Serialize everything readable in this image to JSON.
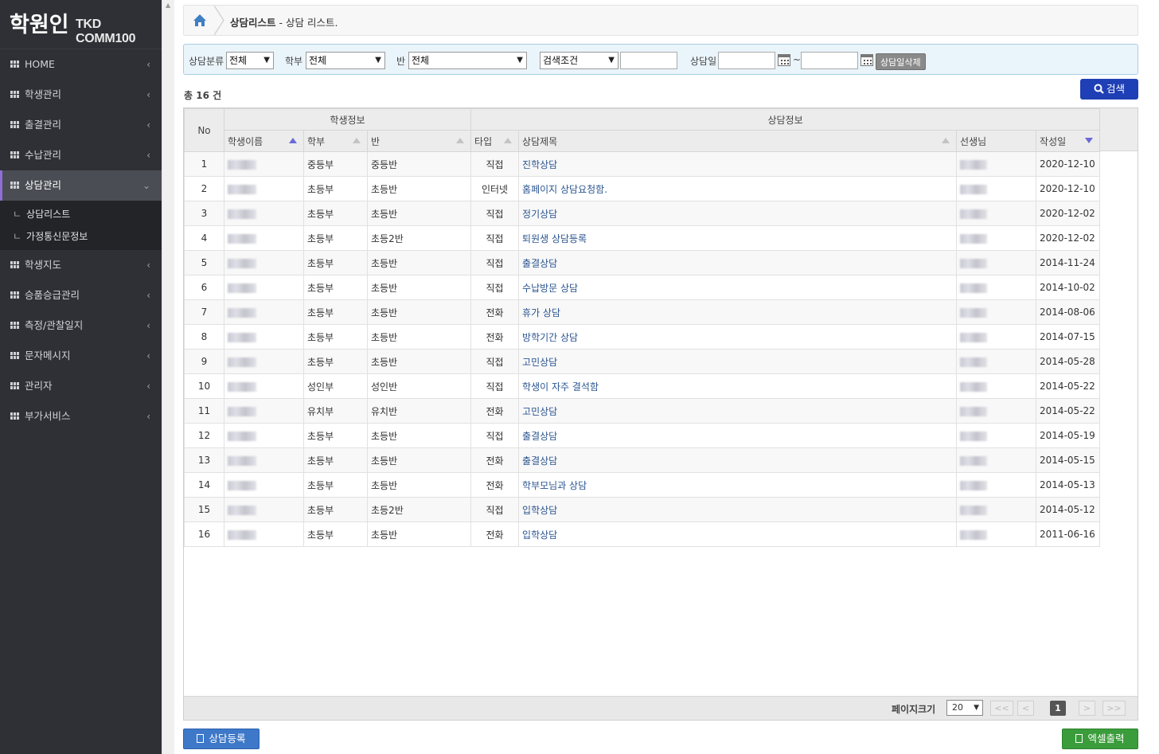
{
  "sidebar": {
    "logo_mark": "학원인",
    "logo_text": "TKD COMM100",
    "menu": [
      {
        "label": "HOME",
        "arrow": "‹"
      },
      {
        "label": "학생관리",
        "arrow": "‹"
      },
      {
        "label": "출결관리",
        "arrow": "‹"
      },
      {
        "label": "수납관리",
        "arrow": "‹"
      },
      {
        "label": "상담관리",
        "arrow": "⌄"
      },
      {
        "label": "학생지도",
        "arrow": "‹"
      },
      {
        "label": "승품승급관리",
        "arrow": "‹"
      },
      {
        "label": "측정/관찰일지",
        "arrow": "‹"
      },
      {
        "label": "문자메시지",
        "arrow": "‹"
      },
      {
        "label": "관리자",
        "arrow": "‹"
      },
      {
        "label": "부가서비스",
        "arrow": "‹"
      }
    ],
    "submenu": [
      {
        "mark": "ㄴ",
        "label": "상담리스트"
      },
      {
        "mark": "ㄴ",
        "label": "가정통신문정보"
      }
    ]
  },
  "breadcrumb": {
    "title": "상담리스트",
    "separator": " - ",
    "sub": "상담 리스트."
  },
  "search": {
    "category_label": "상담분류",
    "category_value": "전체",
    "dept_label": "학부",
    "dept_value": "전체",
    "class_label": "반",
    "class_value": "전체",
    "condition_value": "검색조건",
    "date_label": "상담일",
    "tilde": "~",
    "delete_date_label": "상담일삭제",
    "search_button": "검색"
  },
  "summary": {
    "total_text": "총 16 건"
  },
  "table": {
    "group_no": "No",
    "group_student": "학생정보",
    "group_counsel": "상담정보",
    "headers": {
      "name": "학생이름",
      "dept": "학부",
      "class": "반",
      "type": "타입",
      "subject": "상담제목",
      "teacher": "선생님",
      "date": "작성일"
    },
    "rows": [
      {
        "no": "1",
        "dept": "중등부",
        "class": "중등반",
        "type": "직접",
        "subject": "진학상담",
        "date": "2020-12-10"
      },
      {
        "no": "2",
        "dept": "초등부",
        "class": "초등반",
        "type": "인터넷",
        "subject": "홈페이지 상담요청함.",
        "date": "2020-12-10"
      },
      {
        "no": "3",
        "dept": "초등부",
        "class": "초등반",
        "type": "직접",
        "subject": "정기상담",
        "date": "2020-12-02"
      },
      {
        "no": "4",
        "dept": "초등부",
        "class": "초등2반",
        "type": "직접",
        "subject": "퇴원생 상담등록",
        "date": "2020-12-02"
      },
      {
        "no": "5",
        "dept": "초등부",
        "class": "초등반",
        "type": "직접",
        "subject": "출결상담",
        "date": "2014-11-24"
      },
      {
        "no": "6",
        "dept": "초등부",
        "class": "초등반",
        "type": "직접",
        "subject": "수납방문 상담",
        "date": "2014-10-02"
      },
      {
        "no": "7",
        "dept": "초등부",
        "class": "초등반",
        "type": "전화",
        "subject": "휴가 상담",
        "date": "2014-08-06"
      },
      {
        "no": "8",
        "dept": "초등부",
        "class": "초등반",
        "type": "전화",
        "subject": "방학기간 상담",
        "date": "2014-07-15"
      },
      {
        "no": "9",
        "dept": "초등부",
        "class": "초등반",
        "type": "직접",
        "subject": "고민상담",
        "date": "2014-05-28"
      },
      {
        "no": "10",
        "dept": "성인부",
        "class": "성인반",
        "type": "직접",
        "subject": "학생이 자주 결석함",
        "date": "2014-05-22"
      },
      {
        "no": "11",
        "dept": "유치부",
        "class": "유치반",
        "type": "전화",
        "subject": "고민상담",
        "date": "2014-05-22"
      },
      {
        "no": "12",
        "dept": "초등부",
        "class": "초등반",
        "type": "직접",
        "subject": "출결상담",
        "date": "2014-05-19"
      },
      {
        "no": "13",
        "dept": "초등부",
        "class": "초등반",
        "type": "전화",
        "subject": "출결상담",
        "date": "2014-05-15"
      },
      {
        "no": "14",
        "dept": "초등부",
        "class": "초등반",
        "type": "전화",
        "subject": "학부모님과 상담",
        "date": "2014-05-13"
      },
      {
        "no": "15",
        "dept": "초등부",
        "class": "초등2반",
        "type": "직접",
        "subject": "입학상담",
        "date": "2014-05-12"
      },
      {
        "no": "16",
        "dept": "초등부",
        "class": "초등반",
        "type": "전화",
        "subject": "입학상담",
        "date": "2011-06-16"
      }
    ]
  },
  "pager": {
    "page_size_label": "페이지크기",
    "page_size": "20",
    "first": "<<",
    "prev": "<",
    "current": "1",
    "next": ">",
    "last": ">>"
  },
  "buttons": {
    "register": "상담등록",
    "excel": "엑셀출력"
  },
  "colors": {
    "sidebar_bg": "#2e3035",
    "active_accent": "#8f6ed5",
    "search_button": "#1e3fb5",
    "register_button": "#3d78c9",
    "excel_button": "#3a9c3a",
    "link_text": "#2b5590"
  }
}
